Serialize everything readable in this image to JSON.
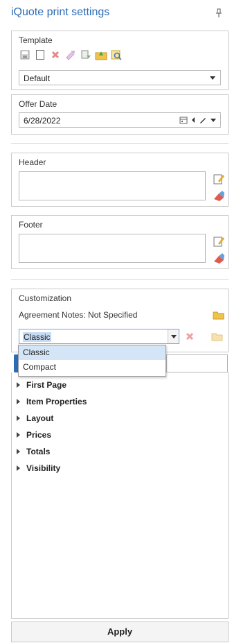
{
  "panel": {
    "title": "iQuote print settings"
  },
  "template": {
    "label": "Template",
    "selected": "Default",
    "toolbar_icons": [
      "save-icon",
      "new-icon",
      "delete-icon",
      "rename-icon",
      "copy-icon",
      "import-icon",
      "export-icon"
    ]
  },
  "offer_date": {
    "label": "Offer Date",
    "value": "6/28/2022"
  },
  "header": {
    "label": "Header",
    "value": ""
  },
  "footer": {
    "label": "Footer",
    "value": ""
  },
  "customization": {
    "label": "Customization",
    "agreement_notes": "Agreement Notes: Not Specified",
    "selected": "Classic",
    "options": [
      "Classic",
      "Compact"
    ]
  },
  "tree": {
    "items": [
      "First Page",
      "Item Properties",
      "Layout",
      "Prices",
      "Totals",
      "Visibility"
    ]
  },
  "apply_label": "Apply",
  "colors": {
    "accent": "#2b6cb8",
    "border": "#c9c9c9",
    "selection": "#c5daf3"
  }
}
